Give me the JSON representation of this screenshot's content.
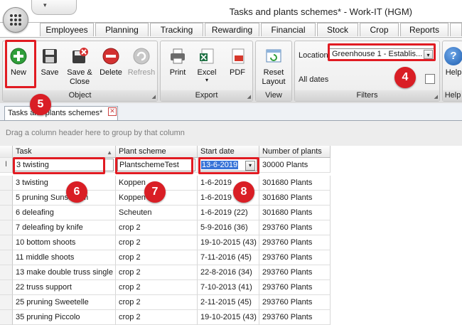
{
  "window": {
    "title": "Tasks and plants schemes* - Work-IT (HGM)",
    "qat_dropdown_icon": "chevron-down-icon"
  },
  "ribbon_tabs": [
    "Employees",
    "Planning",
    "Tracking",
    "Rewarding",
    "Financial",
    "Stock",
    "Crop",
    "Reports"
  ],
  "ribbon": {
    "groups": {
      "object": "Object",
      "export": "Export",
      "view": "View",
      "filters": "Filters",
      "help": "Help"
    },
    "buttons": {
      "new": "New",
      "save": "Save",
      "save_close_1": "Save &",
      "save_close_2": "Close",
      "delete": "Delete",
      "refresh": "Refresh",
      "print": "Print",
      "excel": "Excel",
      "pdf": "PDF",
      "reset_1": "Reset",
      "reset_2": "Layout",
      "help": "Help"
    },
    "filters": {
      "location_label": "Location",
      "location_value": "Greenhouse 1 - Establis...",
      "all_dates_label": "All dates",
      "all_dates_checked": false
    }
  },
  "document_tab": {
    "label": "Tasks and plants schemes*"
  },
  "group_panel": {
    "hint": "Drag a column header here to group by that column"
  },
  "grid": {
    "columns": [
      "Task",
      "Plant scheme",
      "Start date",
      "Number of plants"
    ],
    "new_row": {
      "task": "3 twisting",
      "plant_scheme": "PlantschemeTest",
      "start_date": "13-6-2019",
      "number_of_plants": "30000 Plants"
    },
    "rows": [
      {
        "task": "3 twisting",
        "plant_scheme": "Koppen",
        "start_date": "1-6-2019",
        "number_of_plants": "301680 Plants"
      },
      {
        "task": "5 pruning Sunstream",
        "plant_scheme": "Koppen",
        "start_date": "1-6-2019",
        "number_of_plants": "301680 Plants"
      },
      {
        "task": "6 deleafing",
        "plant_scheme": "Scheuten",
        "start_date": "1-6-2019 (22)",
        "number_of_plants": "301680 Plants"
      },
      {
        "task": "7 deleafing by knife",
        "plant_scheme": "crop 2",
        "start_date": "5-9-2016 (36)",
        "number_of_plants": "293760 Plants"
      },
      {
        "task": "10 bottom shoots",
        "plant_scheme": "crop 2",
        "start_date": "19-10-2015 (43)",
        "number_of_plants": "293760 Plants"
      },
      {
        "task": "11 middle shoots",
        "plant_scheme": "crop 2",
        "start_date": "7-11-2016 (45)",
        "number_of_plants": "293760 Plants"
      },
      {
        "task": "13 make double truss single",
        "plant_scheme": "crop 2",
        "start_date": "22-8-2016 (34)",
        "number_of_plants": "293760 Plants"
      },
      {
        "task": "22 truss support",
        "plant_scheme": "crop 2",
        "start_date": "7-10-2013 (41)",
        "number_of_plants": "293760 Plants"
      },
      {
        "task": "25 pruning Sweetelle",
        "plant_scheme": "crop 2",
        "start_date": "2-11-2015 (45)",
        "number_of_plants": "293760 Plants"
      },
      {
        "task": "35 pruning Piccolo",
        "plant_scheme": "crop 2",
        "start_date": "19-10-2015 (43)",
        "number_of_plants": "293760 Plants"
      }
    ]
  },
  "callouts": [
    "4",
    "5",
    "6",
    "7",
    "8"
  ],
  "colors": {
    "callout_red": "#e11b22",
    "selection_blue": "#3874d8"
  }
}
